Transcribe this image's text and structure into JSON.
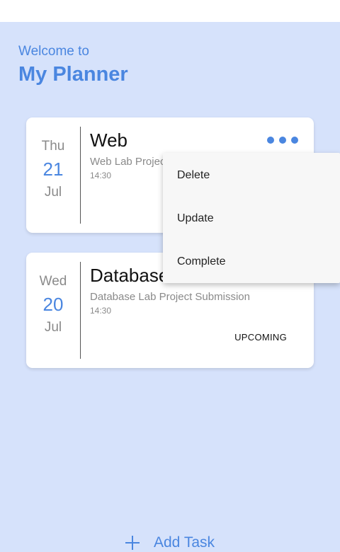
{
  "header": {
    "welcome": "Welcome to",
    "title": "My Planner"
  },
  "tasks": [
    {
      "dow": "Thu",
      "day": "21",
      "month": "Jul",
      "title": "Web",
      "description": "Web Lab Project Submission",
      "time": "14:30",
      "status": ""
    },
    {
      "dow": "Wed",
      "day": "20",
      "month": "Jul",
      "title": "Database",
      "description": "Database Lab Project Submission",
      "time": "14:30",
      "status": "UPCOMING"
    }
  ],
  "menu": {
    "items": [
      "Delete",
      "Update",
      "Complete"
    ]
  },
  "footer": {
    "add_task_label": "Add Task"
  },
  "colors": {
    "accent": "#4a86e0",
    "background": "#d6e2fb"
  },
  "icons": {
    "more": "more-horizontal-icon",
    "add": "plus-icon"
  }
}
